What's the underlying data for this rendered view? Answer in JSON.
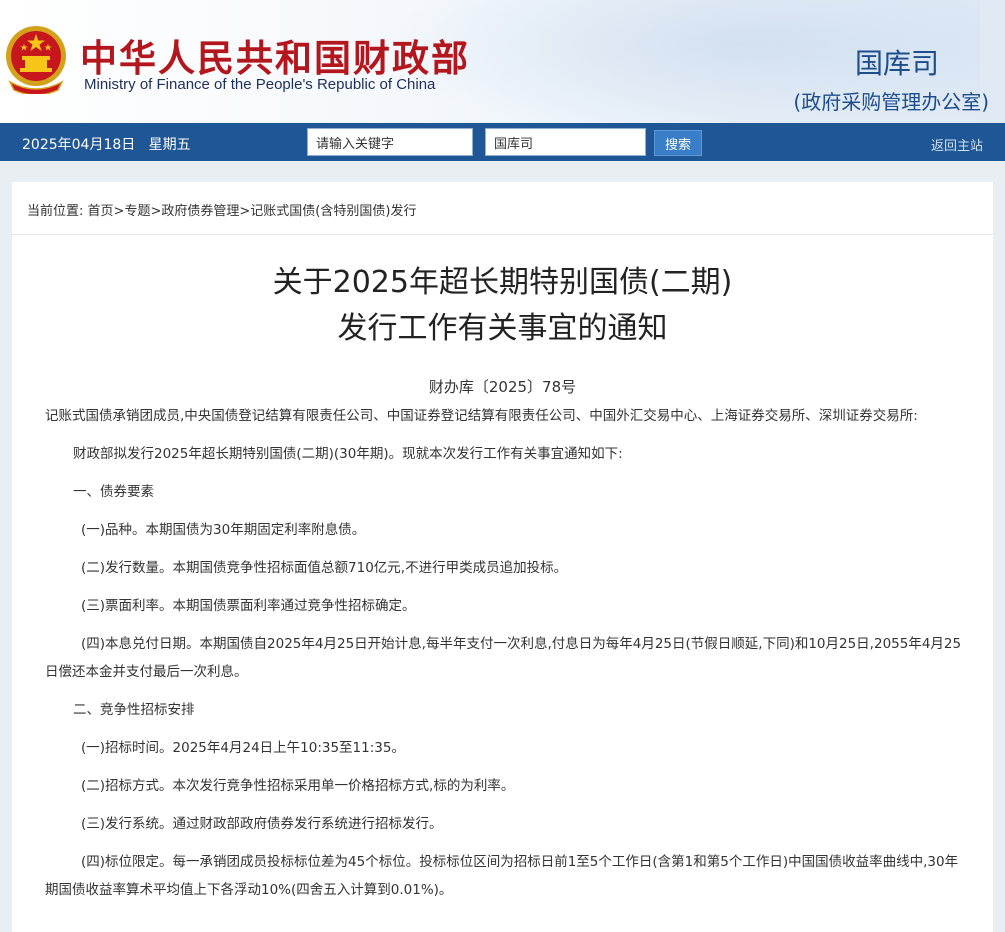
{
  "header": {
    "title_cn": "中华人民共和国财政部",
    "title_en": "Ministry of Finance of the People's Republic of China",
    "department": "国库司",
    "department_sub": "(政府采购管理办公室)",
    "emblem_icon": "national-emblem-icon"
  },
  "navbar": {
    "date": "2025年04月18日   星期五",
    "keyword_placeholder": "请输入关键字",
    "keyword_value": "请输入关键字",
    "dept_value": "国库司",
    "search_label": "搜索",
    "home_label": "返回主站"
  },
  "breadcrumb": {
    "prefix": "当前位置:",
    "items": [
      "首页",
      "专题",
      "政府债券管理",
      "记账式国债(含特别国债)发行"
    ]
  },
  "document": {
    "title_line1": "关于2025年超长期特别国债(二期)",
    "title_line2": "发行工作有关事宜的通知",
    "number": "财办库〔2025〕78号",
    "paragraphs": [
      "记账式国债承销团成员,中央国债登记结算有限责任公司、中国证券登记结算有限责任公司、中国外汇交易中心、上海证券交易所、深圳证券交易所:",
      "财政部拟发行2025年超长期特别国债(二期)(30年期)。现就本次发行工作有关事宜通知如下:",
      "一、债券要素",
      "(一)品种。本期国债为30年期固定利率附息债。",
      "(二)发行数量。本期国债竞争性招标面值总额710亿元,不进行甲类成员追加投标。",
      "(三)票面利率。本期国债票面利率通过竞争性招标确定。",
      "(四)本息兑付日期。本期国债自2025年4月25日开始计息,每半年支付一次利息,付息日为每年4月25日(节假日顺延,下同)和10月25日,2055年4月25日偿还本金并支付最后一次利息。",
      "二、竞争性招标安排",
      "(一)招标时间。2025年4月24日上午10:35至11:35。",
      "(二)招标方式。本次发行竞争性招标采用单一价格招标方式,标的为利率。",
      "(三)发行系统。通过财政部政府债券发行系统进行招标发行。",
      "(四)标位限定。每一承销团成员投标标位差为45个标位。投标标位区间为招标日前1至5个工作日(含第1和第5个工作日)中国国债收益率曲线中,30年期国债收益率算术平均值上下各浮动10%(四舍五入计算到0.01%)。"
    ]
  },
  "colors": {
    "brand_red": "#b3161d",
    "nav_blue": "#1f5696",
    "dept_blue": "#1f4d8c"
  }
}
